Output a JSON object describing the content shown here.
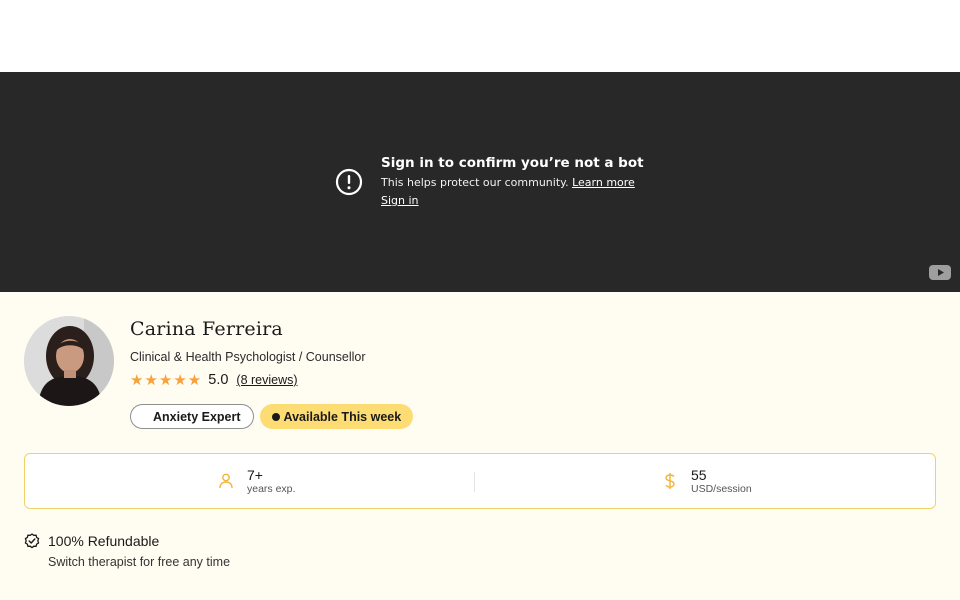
{
  "video_notice": {
    "title": "Sign in to confirm you’re not a bot",
    "body": "This helps protect our community.",
    "learn_more": "Learn more",
    "sign_in": "Sign in"
  },
  "therapist": {
    "name": "Carina Ferreira",
    "role": "Clinical & Health Psychologist / Counsellor",
    "stars": "★★★★★",
    "rating": "5.0",
    "reviews": "(8 reviews)",
    "tags": [
      "Anxiety Expert",
      "Available This week"
    ]
  },
  "stats": [
    {
      "value": "7+",
      "label": "years exp.",
      "icon": "person-icon"
    },
    {
      "value": "55",
      "label": "USD/session",
      "icon": "dollar-icon"
    }
  ],
  "refund": {
    "title": "100% Refundable",
    "subtitle": "Switch therapist for free any time"
  },
  "colors": {
    "star": "#f7a23b",
    "accent_yellow": "#fddc74",
    "stat_border": "#f0d26b",
    "video_bg": "#282828",
    "profile_bg": "#fffcf2"
  }
}
